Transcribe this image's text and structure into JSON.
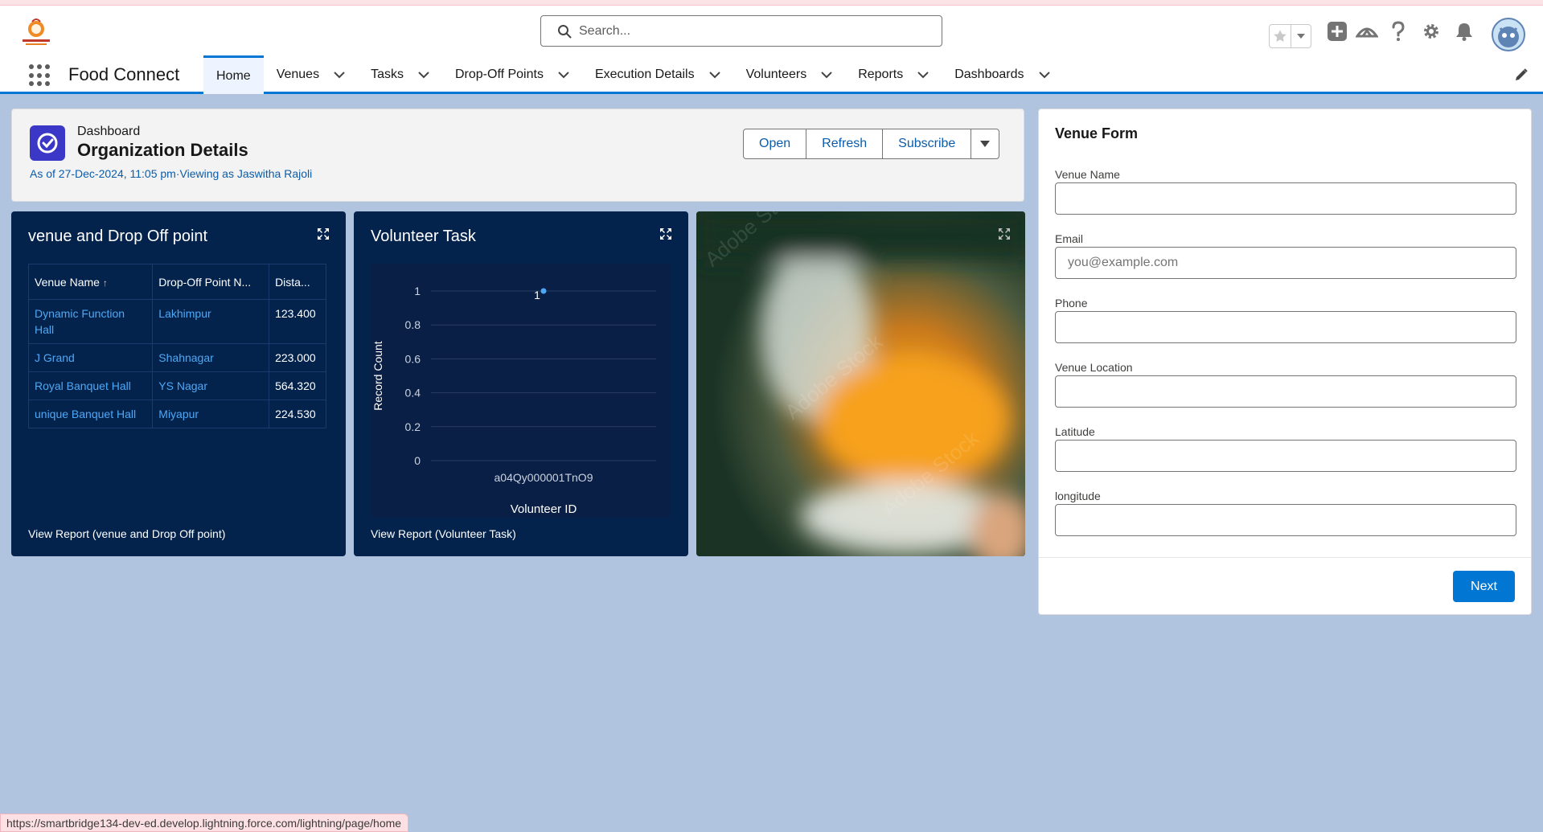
{
  "app": {
    "name": "Food Connect",
    "logo_text": "FOOD CONNECT"
  },
  "search": {
    "placeholder": "Search..."
  },
  "nav": {
    "items": [
      {
        "label": "Home",
        "active": true,
        "has_menu": false
      },
      {
        "label": "Venues",
        "has_menu": true
      },
      {
        "label": "Tasks",
        "has_menu": true
      },
      {
        "label": "Drop-Off Points",
        "has_menu": true
      },
      {
        "label": "Execution Details",
        "has_menu": true
      },
      {
        "label": "Volunteers",
        "has_menu": true
      },
      {
        "label": "Reports",
        "has_menu": true
      },
      {
        "label": "Dashboards",
        "has_menu": true
      }
    ]
  },
  "dashboard": {
    "type_label": "Dashboard",
    "title": "Organization Details",
    "subtitle": "As of 27-Dec-2024, 11:05 pm·Viewing as Jaswitha Rajoli",
    "buttons": {
      "open": "Open",
      "refresh": "Refresh",
      "subscribe": "Subscribe"
    }
  },
  "venue_card": {
    "title": "venue and Drop Off point",
    "columns": [
      "Venue Name",
      "Drop-Off Point N...",
      "Dista..."
    ],
    "rows": [
      {
        "venue": "Dynamic Function Hall",
        "drop": "Lakhimpur",
        "distance": "123.400"
      },
      {
        "venue": "J Grand",
        "drop": "Shahnagar",
        "distance": "223.000"
      },
      {
        "venue": "Royal Banquet Hall",
        "drop": "YS Nagar",
        "distance": "564.320"
      },
      {
        "venue": "unique Banquet Hall",
        "drop": "Miyapur",
        "distance": "224.530"
      }
    ],
    "view_report": "View Report (venue and Drop Off point)"
  },
  "volunteer_card": {
    "title": "Volunteer Task",
    "view_report": "View Report (Volunteer Task)"
  },
  "chart_data": {
    "type": "scatter",
    "title": "Volunteer Task",
    "xlabel": "Volunteer ID",
    "ylabel": "Record Count",
    "categories": [
      "a04Qy000001TnO9"
    ],
    "values": [
      1
    ],
    "data_labels": [
      "1"
    ],
    "ylim": [
      0,
      1
    ],
    "yticks": [
      "0",
      "0.2",
      "0.4",
      "0.6",
      "0.8",
      "1"
    ],
    "grid": true,
    "point_color": "#4ea8f5"
  },
  "venue_form": {
    "title": "Venue Form",
    "fields": [
      {
        "label": "Venue Name",
        "placeholder": "",
        "value": ""
      },
      {
        "label": "Email",
        "placeholder": "you@example.com",
        "value": ""
      },
      {
        "label": "Phone",
        "placeholder": "",
        "value": ""
      },
      {
        "label": "Venue Location",
        "placeholder": "",
        "value": ""
      },
      {
        "label": "Latitude",
        "placeholder": "",
        "value": ""
      },
      {
        "label": "longitude",
        "placeholder": "",
        "value": ""
      }
    ],
    "next_label": "Next"
  },
  "status_bar": {
    "url": "https://smartbridge134-dev-ed.develop.lightning.force.com/lightning/page/home"
  },
  "colors": {
    "brand": "#0176d3",
    "card_bg": "#03234d",
    "link": "#4ea8f5",
    "page_bg": "#b0c4df"
  }
}
